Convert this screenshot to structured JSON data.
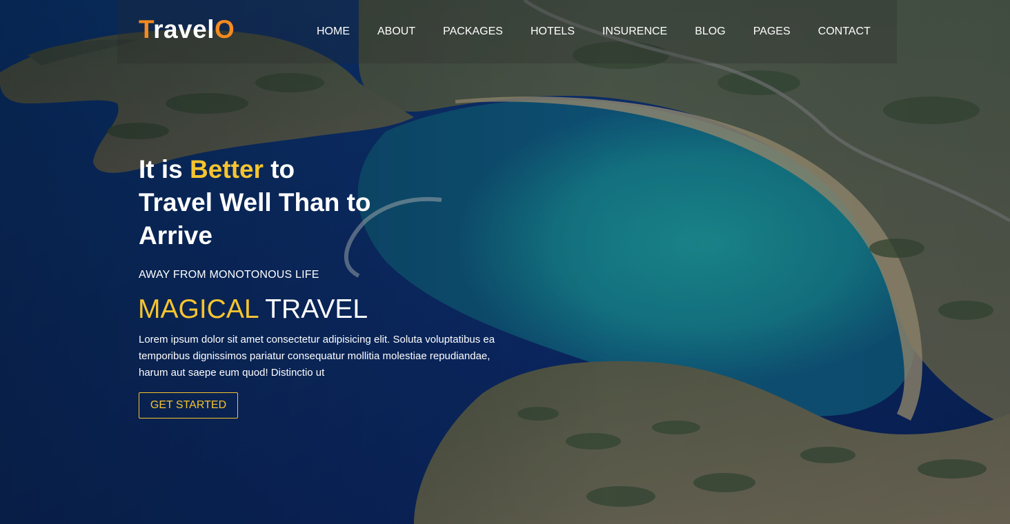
{
  "brand": {
    "logo_first": "T",
    "logo_middle": "ravel",
    "logo_last": "O",
    "accent_color": "#f58a1f"
  },
  "nav": {
    "items": [
      {
        "label": "HOME"
      },
      {
        "label": "ABOUT"
      },
      {
        "label": "PACKAGES"
      },
      {
        "label": "HOTELS"
      },
      {
        "label": "INSURENCE"
      },
      {
        "label": "BLOG"
      },
      {
        "label": "PAGES"
      },
      {
        "label": "CONTACT"
      }
    ]
  },
  "hero": {
    "headline_part1": "It is ",
    "headline_highlight": "Better",
    "headline_part2": " to Travel Well Than to Arrive",
    "subtitle": "AWAY FROM MONOTONOUS LIFE",
    "magic_highlight": "MAGICAL",
    "magic_rest": " TRAVEL",
    "paragraph": "Lorem ipsum dolor sit amet consectetur adipisicing elit. Soluta voluptatibus ea temporibus dignissimos pariatur consequatur mollitia molestiae repudiandae, harum aut saepe eum quod! Distinctio ut",
    "cta_label": "GET STARTED",
    "highlight_color": "#f6c42f"
  }
}
